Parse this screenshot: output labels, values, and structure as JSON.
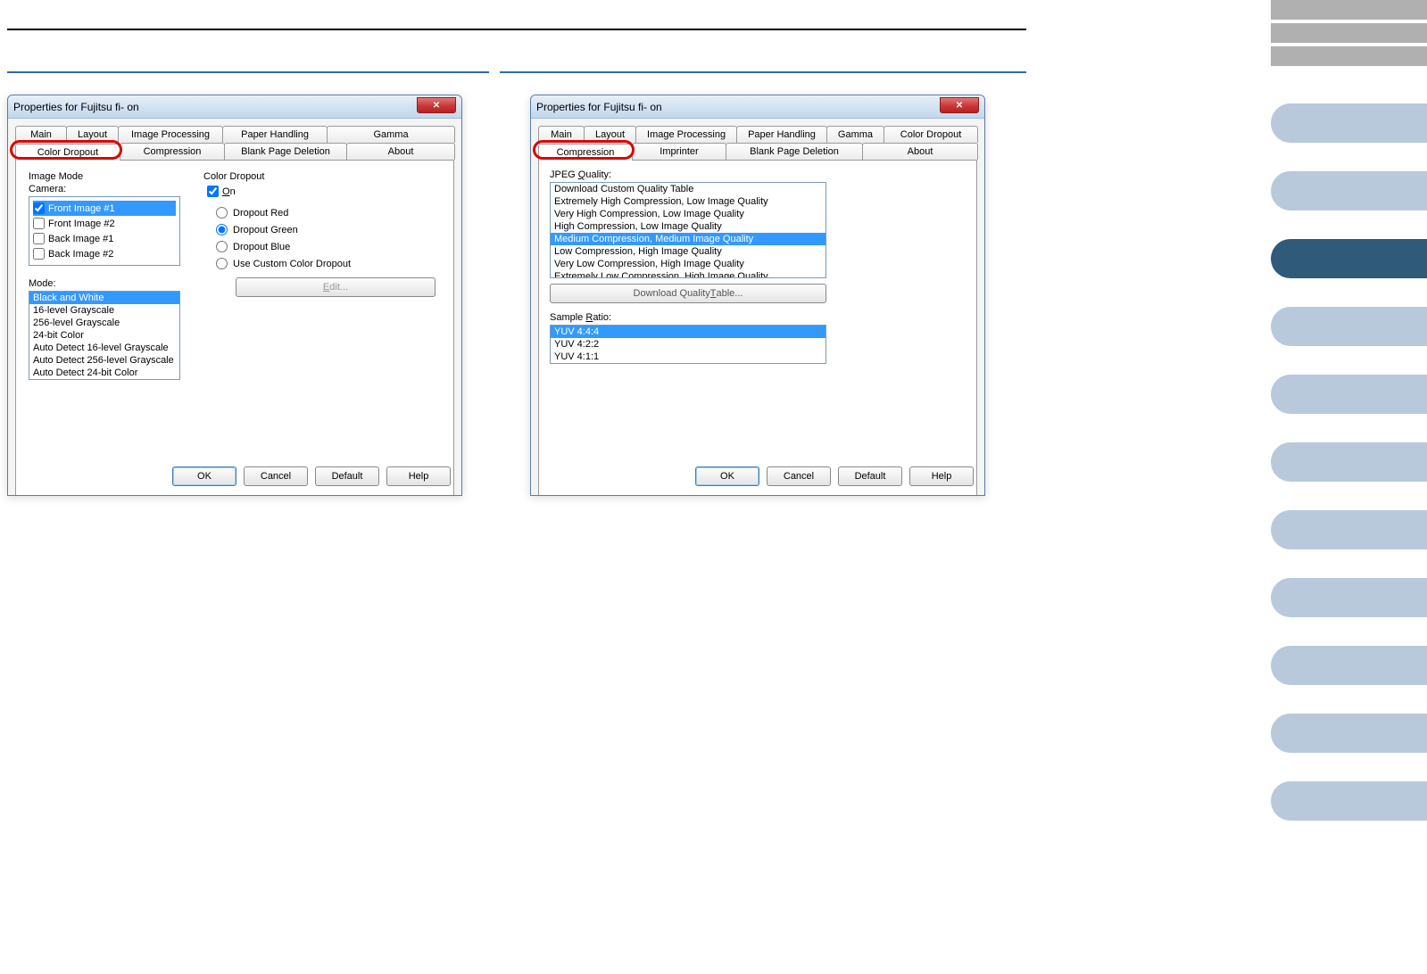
{
  "dialog1": {
    "title": "Properties for Fujitsu fi-        on",
    "tabs_row1": [
      "Main",
      "Layout",
      "Image Processing",
      "Paper Handling",
      "Gamma"
    ],
    "tabs_row2": [
      "Color Dropout",
      "Compression",
      "Blank Page Deletion",
      "About"
    ],
    "active_tab": "Color Dropout",
    "image_mode_label": "Image Mode",
    "camera_label": "Camera:",
    "camera_items": [
      {
        "label": "Front Image #1",
        "checked": true,
        "selected": true
      },
      {
        "label": "Front Image #2",
        "checked": false,
        "selected": false
      },
      {
        "label": "Back Image #1",
        "checked": false,
        "selected": false
      },
      {
        "label": "Back Image #2",
        "checked": false,
        "selected": false
      }
    ],
    "mode_label": "Mode:",
    "modes": [
      "Black and White",
      "16-level Grayscale",
      "256-level Grayscale",
      "24-bit Color",
      "Auto Detect 16-level Grayscale",
      "Auto Detect 256-level Grayscale",
      "Auto Detect 24-bit Color"
    ],
    "mode_selected": "Black and White",
    "color_dropout_label": "Color Dropout",
    "on_label": "On",
    "radios": [
      "Dropout Red",
      "Dropout Green",
      "Dropout Blue",
      "Use Custom Color Dropout"
    ],
    "radio_selected": "Dropout Green",
    "edit_btn": "Edit...",
    "buttons": {
      "ok": "OK",
      "cancel": "Cancel",
      "default": "Default",
      "help": "Help"
    }
  },
  "dialog2": {
    "title": "Properties for Fujitsu fi-        on",
    "tabs_row1": [
      "Main",
      "Layout",
      "Image Processing",
      "Paper Handling",
      "Gamma",
      "Color Dropout"
    ],
    "tabs_row2": [
      "Compression",
      "Imprinter",
      "Blank Page Deletion",
      "About"
    ],
    "active_tab": "Compression",
    "jpeg_label": "JPEG Quality:",
    "jpeg_items": [
      "Download Custom Quality Table",
      "Extremely High Compression, Low Image Quality",
      "Very High Compression, Low Image Quality",
      "High Compression, Low Image Quality",
      "Medium Compression, Medium Image Quality",
      "Low Compression, High Image Quality",
      "Very Low Compression, High Image Quality",
      "Extremely Low Compression, High Image Quality"
    ],
    "jpeg_selected": "Medium Compression, Medium Image Quality",
    "download_btn": "Download Quality Table...",
    "sample_label": "Sample Ratio:",
    "sample_items": [
      "YUV 4:4:4",
      "YUV 4:2:2",
      "YUV 4:1:1"
    ],
    "sample_selected": "YUV 4:4:4",
    "buttons": {
      "ok": "OK",
      "cancel": "Cancel",
      "default": "Default",
      "help": "Help"
    }
  }
}
